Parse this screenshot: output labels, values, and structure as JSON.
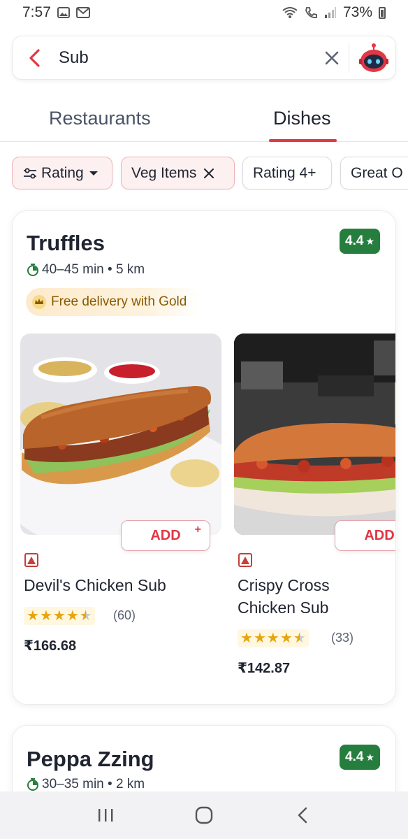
{
  "status_bar": {
    "time": "7:57",
    "battery": "73%"
  },
  "search": {
    "value": "Sub"
  },
  "tabs": [
    {
      "label": "Restaurants"
    },
    {
      "label": "Dishes"
    }
  ],
  "filters": [
    {
      "label": "Rating"
    },
    {
      "label": "Veg Items"
    },
    {
      "label": "Rating 4+"
    },
    {
      "label": "Great O"
    }
  ],
  "restaurants": [
    {
      "name": "Truffles",
      "rating": "4.4",
      "meta": "40–45 min • 5 km",
      "gold_banner": "Free delivery with Gold",
      "dishes": [
        {
          "name": "Devil's Chicken Sub",
          "reviews": "(60)",
          "price": "₹166.68",
          "add_label": "ADD",
          "stars": 4.5
        },
        {
          "name": "Crispy Cross Chicken Sub",
          "reviews": "(33)",
          "price": "₹142.87",
          "add_label": "ADD",
          "stars": 4.5
        }
      ]
    },
    {
      "name": "Peppa Zzing",
      "rating": "4.4",
      "meta": "30–35 min • 2 km"
    }
  ],
  "colors": {
    "brand_red": "#e23744",
    "rating_green": "#267e3e",
    "gold_text": "#8a5a00"
  }
}
